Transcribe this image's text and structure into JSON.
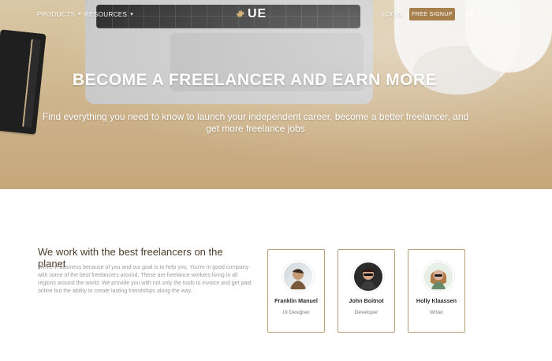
{
  "nav": {
    "products_label": "PRODUCTS",
    "resources_label": "RESOURCES",
    "logo_text": "UE",
    "login_label": "LOGIN",
    "signup_label": "FREE SIGNUP",
    "icons": {
      "dropdown": "chevron-down-icon",
      "search": "search-icon",
      "logo_gear": "gear-icon"
    }
  },
  "hero": {
    "title": "BECOME A FREELANCER AND EARN MORE",
    "subtitle": "Find everything you need to know to launch your independent career, become a better freelancer, and get more freelance jobs"
  },
  "section": {
    "title": "We work with the best freelancers on the planet",
    "body": "We’re in business because of you and our goal is to help you. You’re in good company with some of the best freelancers around. These are freelance workers living in all regions around the world. We provide you with not only the tools to invoice and get paid online but the ability to create lasting friendships along the way."
  },
  "freelancers": [
    {
      "name": "Franklin Manuel",
      "role": "UI Designer"
    },
    {
      "name": "John Boitnot",
      "role": "Developer"
    },
    {
      "name": "Holly Klaassen",
      "role": "Writer"
    }
  ],
  "colors": {
    "accent_brown": "#a67f4d",
    "card_border": "#b8a07b",
    "section_title": "#4b3b27"
  }
}
